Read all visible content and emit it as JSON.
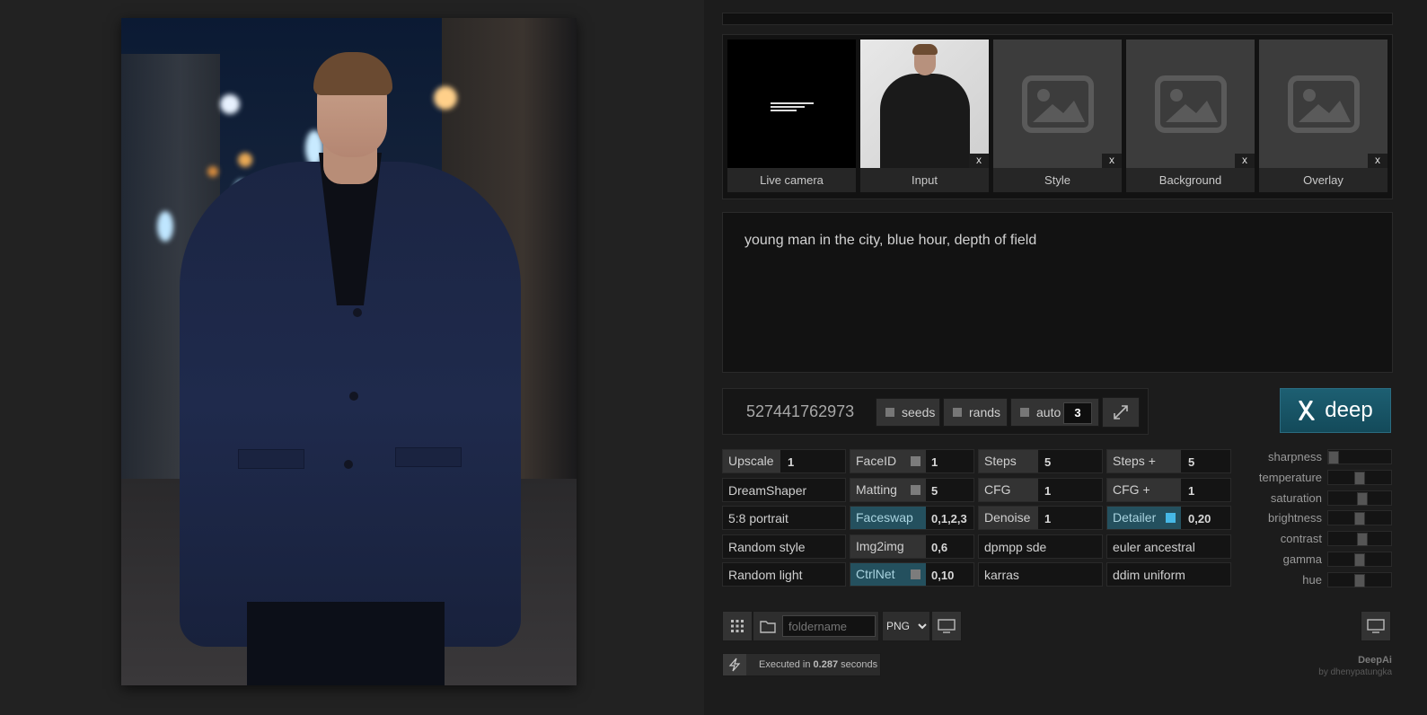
{
  "thumbnails": [
    {
      "label": "Live camera",
      "has_close": false
    },
    {
      "label": "Input",
      "has_close": true,
      "close": "x"
    },
    {
      "label": "Style",
      "has_close": true,
      "close": "x"
    },
    {
      "label": "Background",
      "has_close": true,
      "close": "x"
    },
    {
      "label": "Overlay",
      "has_close": true,
      "close": "x"
    }
  ],
  "prompt": "young man in the city, blue hour, depth of field",
  "seed": {
    "value": "527441762973",
    "seeds_label": "seeds",
    "rands_label": "rands",
    "auto_label": "auto",
    "auto_count": "3"
  },
  "deep_button": {
    "label": "deep",
    "icon": "deep-logo-icon"
  },
  "settings": {
    "col1": [
      {
        "label": "Upscale",
        "value": "1",
        "button": true
      },
      {
        "label": "DreamShaper"
      },
      {
        "label": "5:8 portrait"
      },
      {
        "label": "Random style"
      },
      {
        "label": "Random light"
      }
    ],
    "col2": [
      {
        "label": "FaceID",
        "value": "1",
        "on": false
      },
      {
        "label": "Matting",
        "value": "5",
        "on": false
      },
      {
        "label": "Faceswap",
        "value": "0,1,2,3",
        "on": true
      },
      {
        "label": "Img2img",
        "value": "0,6",
        "on": false
      },
      {
        "label": "CtrlNet",
        "value": "0,10",
        "on": true
      }
    ],
    "col3": [
      {
        "label": "Steps",
        "value": "5",
        "button": true
      },
      {
        "label": "CFG",
        "value": "1",
        "button": true
      },
      {
        "label": "Denoise",
        "value": "1",
        "button": true
      },
      {
        "label": "dpmpp sde"
      },
      {
        "label": "karras"
      }
    ],
    "col4": [
      {
        "label": "Steps +",
        "value": "5",
        "button": true
      },
      {
        "label": "CFG +",
        "value": "1",
        "button": true
      },
      {
        "label": "Detailer",
        "value": "0,20",
        "button": true,
        "on": true
      },
      {
        "label": "euler ancestral"
      },
      {
        "label": "ddim uniform"
      }
    ]
  },
  "sliders": [
    {
      "label": "sharpness",
      "level": 0.0
    },
    {
      "label": "temperature",
      "level": 0.5
    },
    {
      "label": "saturation",
      "level": 0.55
    },
    {
      "label": "brightness",
      "level": 0.5
    },
    {
      "label": "contrast",
      "level": 0.55
    },
    {
      "label": "gamma",
      "level": 0.5
    },
    {
      "label": "hue",
      "level": 0.5
    }
  ],
  "toolbar": {
    "folder_placeholder": "foldername",
    "format": "PNG",
    "format_options": [
      "PNG"
    ]
  },
  "execution": {
    "prefix": "Executed in ",
    "time": "0.287",
    "suffix": " seconds"
  },
  "brand": {
    "name": "DeepAi",
    "by": "by dhenypatungka"
  },
  "colors": {
    "accent": "#1d5f72",
    "toggle_on": "#24505e",
    "detailer_tick": "#46b8e6"
  }
}
